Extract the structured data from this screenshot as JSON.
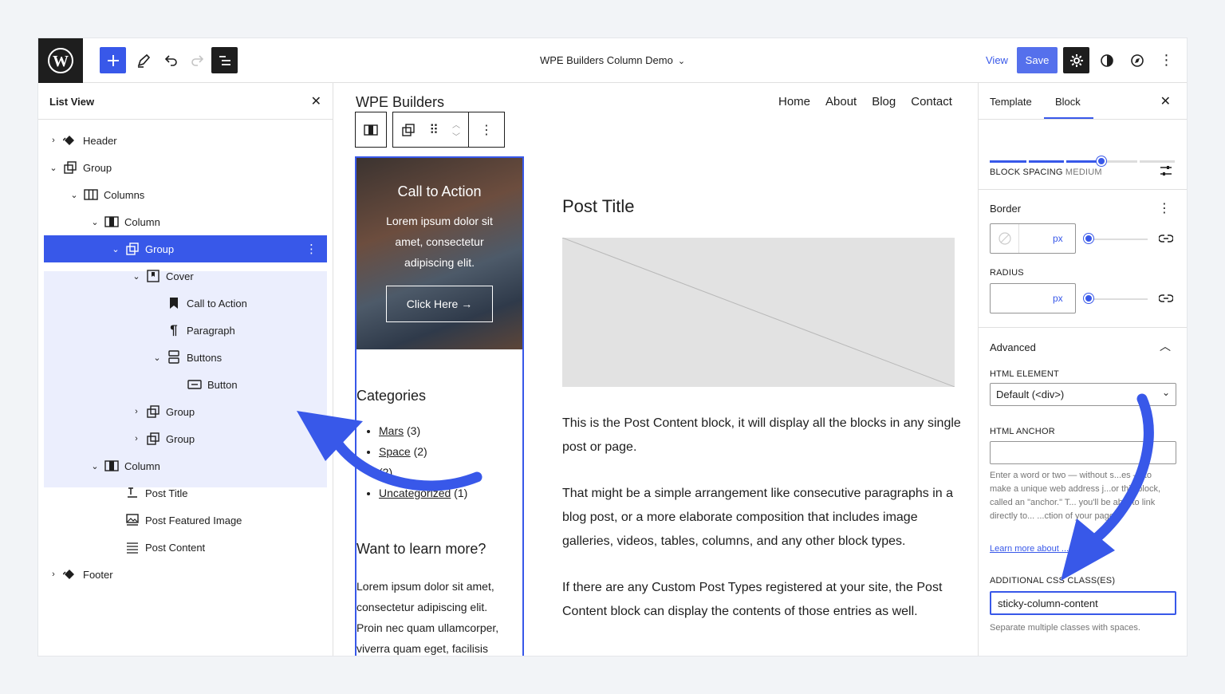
{
  "topbar": {
    "doc_title": "WPE Builders Column Demo",
    "view_label": "View",
    "save_label": "Save"
  },
  "list_view": {
    "title": "List View",
    "items": [
      {
        "label": "Header",
        "icon": "template-part-icon"
      },
      {
        "label": "Group",
        "icon": "group-icon"
      },
      {
        "label": "Columns",
        "icon": "columns-icon"
      },
      {
        "label": "Column",
        "icon": "column-icon"
      },
      {
        "label": "Group",
        "icon": "group-icon",
        "selected": true
      },
      {
        "label": "Cover",
        "icon": "cover-icon"
      },
      {
        "label": "Call to Action",
        "icon": "bookmark-icon"
      },
      {
        "label": "Paragraph",
        "icon": "paragraph-icon"
      },
      {
        "label": "Buttons",
        "icon": "buttons-icon"
      },
      {
        "label": "Button",
        "icon": "button-icon"
      },
      {
        "label": "Group",
        "icon": "group-icon"
      },
      {
        "label": "Group",
        "icon": "group-icon"
      },
      {
        "label": "Column",
        "icon": "column-icon"
      },
      {
        "label": "Post Title",
        "icon": "post-title-icon"
      },
      {
        "label": "Post Featured Image",
        "icon": "featured-image-icon"
      },
      {
        "label": "Post Content",
        "icon": "post-content-icon"
      },
      {
        "label": "Footer",
        "icon": "template-part-icon"
      }
    ]
  },
  "canvas": {
    "site_title": "WPE Builders",
    "nav": [
      "Home",
      "About",
      "Blog",
      "Contact"
    ],
    "cover": {
      "title": "Call to Action",
      "text": "Lorem ipsum dolor sit amet, consectetur adipiscing elit.",
      "button": "Click Here →"
    },
    "categories_title": "Categories",
    "categories": [
      {
        "name": "Mars",
        "count": "(3)"
      },
      {
        "name": "Space",
        "count": "(2)"
      },
      {
        "name": "",
        "count": "(2)"
      },
      {
        "name": "Uncategorized",
        "count": "(1)"
      }
    ],
    "learn_title": "Want to learn more?",
    "learn_text": "Lorem ipsum dolor sit amet, consectetur adipiscing elit. Proin nec quam ullamcorper, viverra quam eget, facilisis",
    "post_title": "Post Title",
    "post_paragraphs": [
      "This is the Post Content block, it will display all the blocks in any single post or page.",
      "That might be a simple arrangement like consecutive paragraphs in a blog post, or a more elaborate composition that includes image galleries, videos, tables, columns, and any other block types.",
      "If there are any Custom Post Types registered at your site, the Post Content block can display the contents of those entries as well."
    ]
  },
  "sidebar": {
    "tab_template": "Template",
    "tab_block": "Block",
    "block_spacing_label": "BLOCK SPACING",
    "block_spacing_value": "MEDIUM",
    "block_spacing_level": 0.6,
    "border_title": "Border",
    "border_unit": "px",
    "radius_label": "RADIUS",
    "radius_unit": "px",
    "advanced_title": "Advanced",
    "html_element_label": "HTML ELEMENT",
    "html_element_value": "Default (<div>)",
    "html_anchor_label": "HTML ANCHOR",
    "html_anchor_value": "",
    "anchor_help": "Enter a word or two — without s...es — to make a unique web address j...or this block, called an \"anchor.\" T... you'll be able to link directly to... ...ction of your page.",
    "learn_more": "Learn more about ...ors",
    "css_label": "ADDITIONAL CSS CLASS(ES)",
    "css_value": "sticky-column-content",
    "css_help": "Separate multiple classes with spaces."
  },
  "colors": {
    "accent": "#3858e9",
    "dark": "#1e1e1e",
    "selection_bg": "#ebeefd"
  }
}
